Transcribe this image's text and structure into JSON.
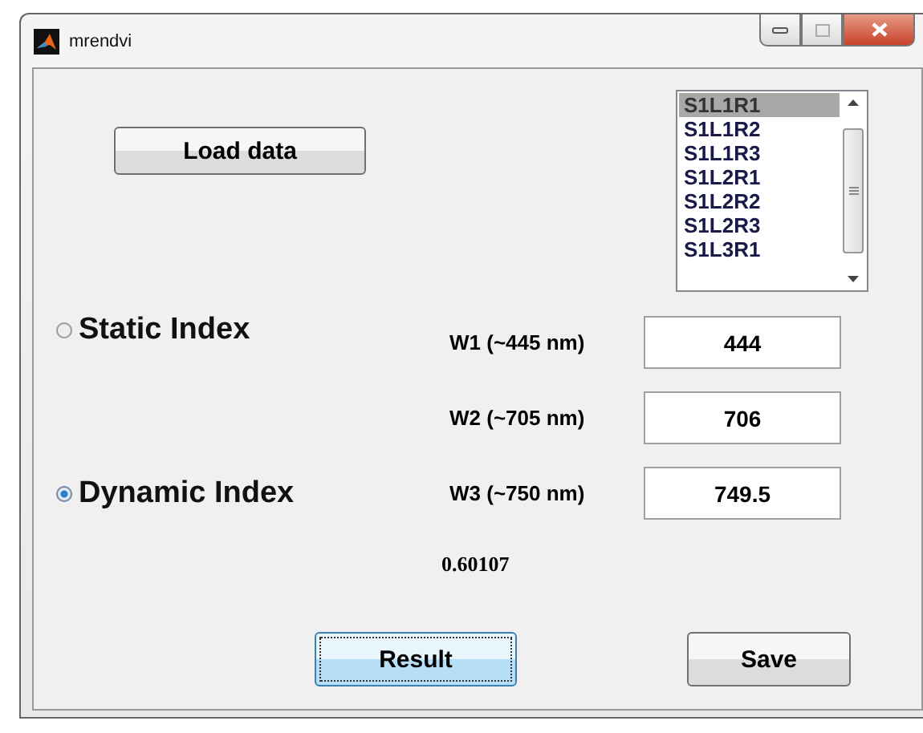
{
  "window": {
    "title": "mrendvi"
  },
  "load_button": "Load data",
  "listbox": {
    "items": [
      {
        "label": "S1L1R1",
        "selected": true
      },
      {
        "label": "S1L1R2",
        "selected": false
      },
      {
        "label": "S1L1R3",
        "selected": false
      },
      {
        "label": "S1L2R1",
        "selected": false
      },
      {
        "label": "S1L2R2",
        "selected": false
      },
      {
        "label": "S1L2R3",
        "selected": false
      },
      {
        "label": "S1L3R1",
        "selected": false
      }
    ]
  },
  "index_options": [
    {
      "label": "Static Index",
      "selected": false
    },
    {
      "label": "Dynamic Index",
      "selected": true
    }
  ],
  "wavelengths": [
    {
      "label": "W1 (~445 nm)",
      "value": "444"
    },
    {
      "label": "W2 (~705 nm)",
      "value": "706"
    },
    {
      "label": "W3 (~750 nm)",
      "value": "749.5"
    }
  ],
  "result_value": "0.60107",
  "buttons": [
    {
      "label": "Result",
      "focused": true
    },
    {
      "label": "Save",
      "focused": false
    }
  ]
}
